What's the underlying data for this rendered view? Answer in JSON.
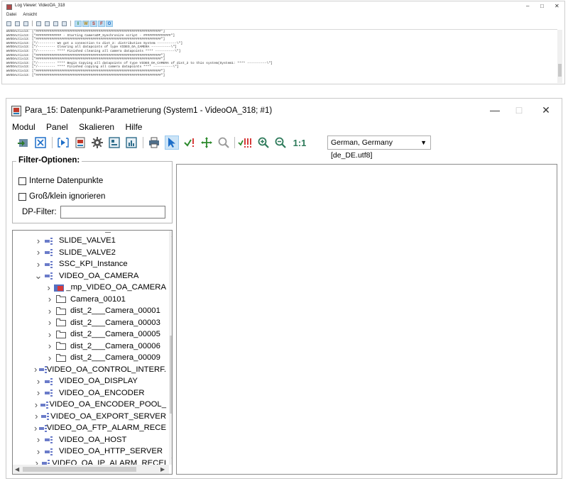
{
  "log_viewer": {
    "title": "Log Viewer: VideoOA_318",
    "menu": [
      "Datei",
      "Ansicht"
    ],
    "filters": [
      "I",
      "W",
      "S",
      "F",
      "O"
    ],
    "lines": [
      "WVOOActiv13: [\"################################################################\"]",
      "WVOOActiv13: [\"############# - Starting CameraDP_Synchronize script - ##############\"]",
      "WVOOActiv13: [\"################################################################\"]",
      "WVOOActiv13: [\"/--------- We got a connection to dist_2: distribution System ----------\\\"]",
      "WVOOActiv13: [\"/--------- Clearing all datapoints of type VIDEO_OA_CAMERA ----------\\\"]",
      "WVOOActiv13: [\"/--------- **** Finished cleaning all camera datapoints **** ----------\\\"]",
      "WVOOActiv13: [\"################################################################\"]",
      "WVOOActiv13: [\"################################################################\"]",
      "WVOOActiv13: [\"/--------- **** Begin Copying all datapoints of type VIDEO_OA_CAMERA of dist_2 to this system(System1: **** ----------\\\"]",
      "WVOOActiv13: [\"/--------- **** Finished copying all camera datapoints **** ----------\\\"]",
      "WVOOActiv13: [\"################################################################\"]",
      "WVOOActiv13: [\"################################################################\"]"
    ]
  },
  "para_window": {
    "title": "Para_15: Datenpunkt-Parametrierung (System1 - VideoOA_318; #1)",
    "menu": [
      "Modul",
      "Panel",
      "Skalieren",
      "Hilfe"
    ],
    "zoom_label": "1:1",
    "language": "German, Germany [de_DE.utf8]",
    "filter": {
      "legend": "Filter-Optionen:",
      "internal_dp": "Interne Datenpunkte",
      "ignore_case": "Groß/klein ignorieren",
      "dp_filter_label": "DP-Filter:",
      "dp_filter_value": ""
    },
    "tree": [
      {
        "label": "SLIDE_VALVE1",
        "type": "dp",
        "level": 0,
        "expanded": false
      },
      {
        "label": "SLIDE_VALVE2",
        "type": "dp",
        "level": 0,
        "expanded": false
      },
      {
        "label": "SSC_KPI_Instance",
        "type": "dp",
        "level": 0,
        "expanded": false
      },
      {
        "label": "VIDEO_OA_CAMERA",
        "type": "dp",
        "level": 0,
        "expanded": true
      },
      {
        "label": "_mp_VIDEO_OA_CAMERA",
        "type": "mp",
        "level": 1,
        "expanded": false
      },
      {
        "label": "Camera_00101",
        "type": "folder",
        "level": 1,
        "expanded": false
      },
      {
        "label": "dist_2___Camera_00001",
        "type": "folder",
        "level": 1,
        "expanded": false
      },
      {
        "label": "dist_2___Camera_00003",
        "type": "folder",
        "level": 1,
        "expanded": false
      },
      {
        "label": "dist_2___Camera_00005",
        "type": "folder",
        "level": 1,
        "expanded": false
      },
      {
        "label": "dist_2___Camera_00006",
        "type": "folder",
        "level": 1,
        "expanded": false
      },
      {
        "label": "dist_2___Camera_00009",
        "type": "folder",
        "level": 1,
        "expanded": false
      },
      {
        "label": "VIDEO_OA_CONTROL_INTERF.",
        "type": "dp",
        "level": 0,
        "expanded": false
      },
      {
        "label": "VIDEO_OA_DISPLAY",
        "type": "dp",
        "level": 0,
        "expanded": false
      },
      {
        "label": "VIDEO_OA_ENCODER",
        "type": "dp",
        "level": 0,
        "expanded": false
      },
      {
        "label": "VIDEO_OA_ENCODER_POOL_",
        "type": "dp",
        "level": 0,
        "expanded": false
      },
      {
        "label": "VIDEO_OA_EXPORT_SERVER",
        "type": "dp",
        "level": 0,
        "expanded": false
      },
      {
        "label": "VIDEO_OA_FTP_ALARM_RECE",
        "type": "dp",
        "level": 0,
        "expanded": false
      },
      {
        "label": "VIDEO_OA_HOST",
        "type": "dp",
        "level": 0,
        "expanded": false
      },
      {
        "label": "VIDEO_OA_HTTP_SERVER",
        "type": "dp",
        "level": 0,
        "expanded": false
      },
      {
        "label": "VIDEO_OA_IP_ALARM_RECEI",
        "type": "dp",
        "level": 0,
        "expanded": false
      }
    ]
  },
  "colors": {
    "accent_blue": "#1f6fc9",
    "dp_icon": "#6a7bc9",
    "alert_red": "#d63a3a",
    "active_tool": "#cce4f7"
  }
}
